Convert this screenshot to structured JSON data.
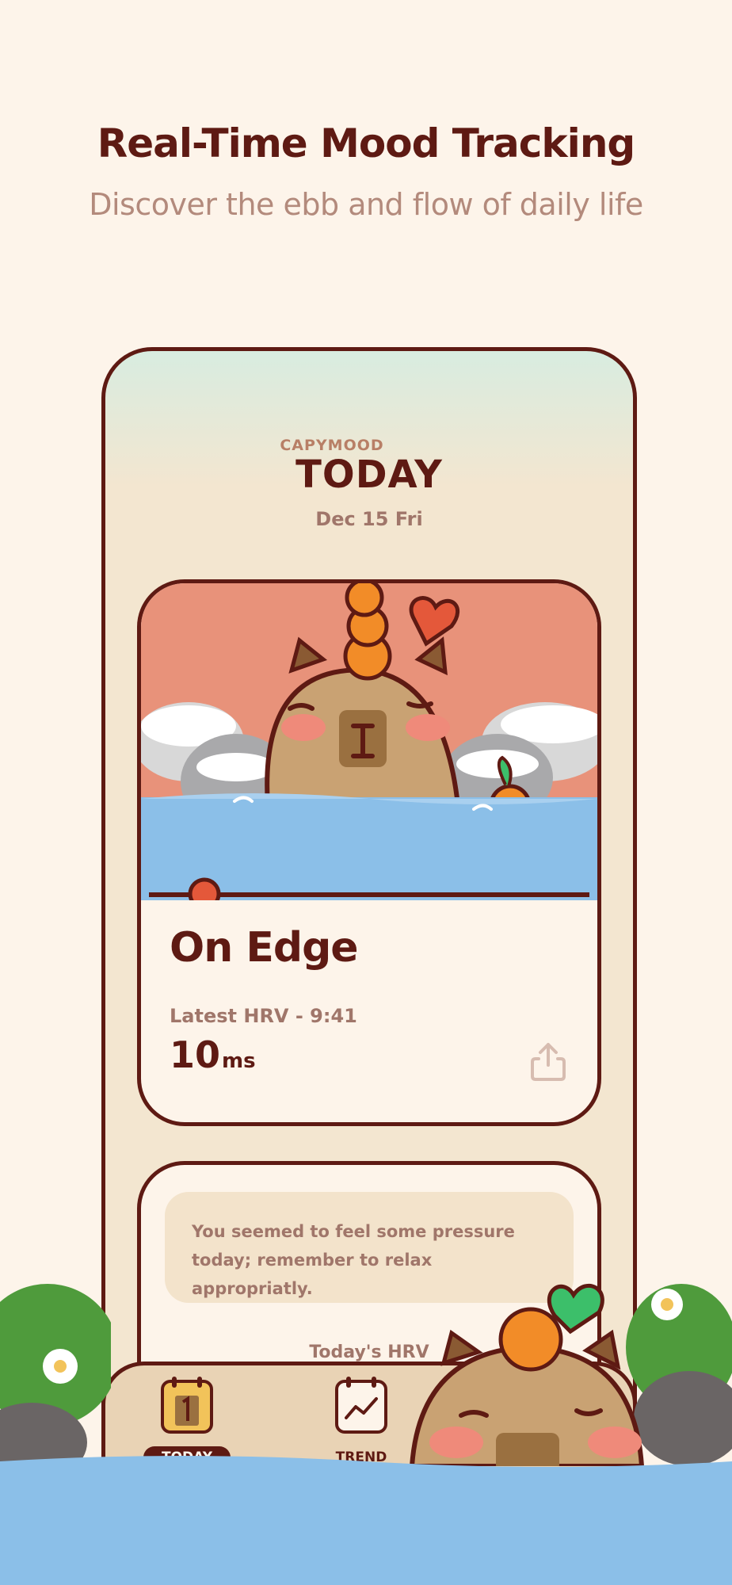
{
  "promo": {
    "headline": "Real-Time Mood Tracking",
    "subline": "Discover the ebb and flow of daily life"
  },
  "app": {
    "brand_small": "CAPYMOOD",
    "brand_big": "TODAY",
    "date": "Dec 15 Fri"
  },
  "mood_card": {
    "mood": "On Edge",
    "hrv_label": "Latest HRV - 9:41",
    "hrv_value": "10",
    "hrv_unit": "ms",
    "share_icon": "share-icon"
  },
  "message_card": {
    "message": "You seemed to feel some pressure today; remember to relax appropriatly.",
    "subtitle": "Today's HRV"
  },
  "tabs": [
    {
      "label": "TODAY",
      "icon": "calendar-icon",
      "active": true
    },
    {
      "label": "TREND",
      "icon": "trend-chart-icon",
      "active": false
    }
  ],
  "colors": {
    "background": "#fdf4ea",
    "brand_dark": "#5e1a13",
    "muted": "#a0766a",
    "accent": "#e4583a",
    "water": "#8bbfe8",
    "sunset": "#e8927a"
  }
}
